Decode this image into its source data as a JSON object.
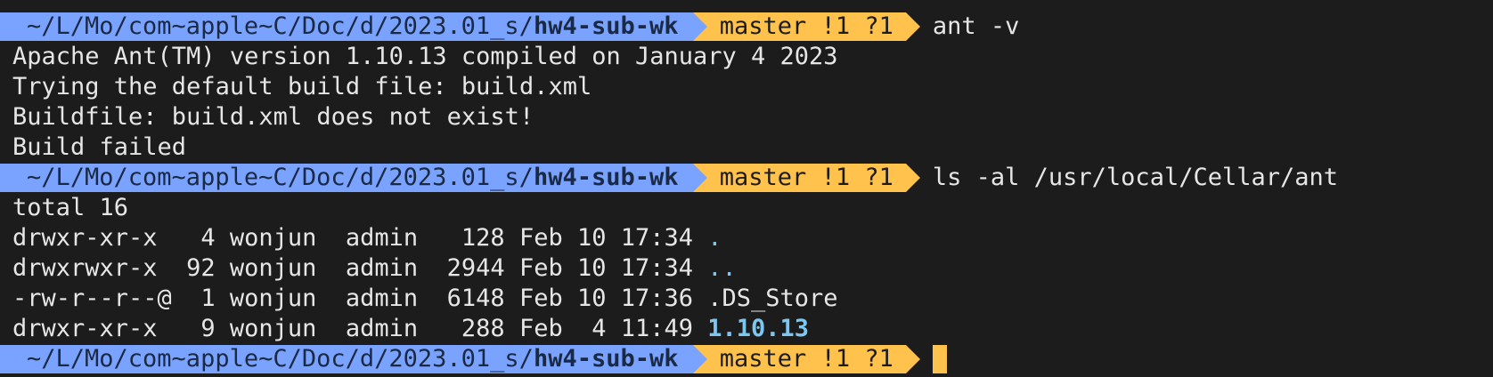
{
  "prompt": {
    "dir_prefix": "~/L/Mo/com~apple~C/Doc/d/2023.01_s/",
    "dir_current": "hw4-sub-wk",
    "git_status": "master !1 ?1"
  },
  "command1": "ant -v",
  "output1": [
    "Apache Ant(TM) version 1.10.13 compiled on January 4 2023",
    "Trying the default build file: build.xml",
    "Buildfile: build.xml does not exist!",
    "Build failed"
  ],
  "command2": "ls -al /usr/local/Cellar/ant",
  "ls": {
    "total": "total 16",
    "rows": [
      {
        "meta": "drwxr-xr-x   4 wonjun  admin   128 Feb 10 17:34 ",
        "name": "."
      },
      {
        "meta": "drwxrwxr-x  92 wonjun  admin  2944 Feb 10 17:34 ",
        "name": ".."
      },
      {
        "meta": "-rw-r--r--@  1 wonjun  admin  6148 Feb 10 17:36 ",
        "name": ".DS_Store"
      },
      {
        "meta": "drwxr-xr-x   9 wonjun  admin   288 Feb  4 11:49 ",
        "name": "1.10.13"
      }
    ]
  },
  "colors": {
    "background": "#1c1c1c",
    "dir_segment": "#7aa2ff",
    "git_segment": "#ffc24d",
    "directory_entry": "#7cc7f0",
    "text": "#e6e6e6"
  }
}
